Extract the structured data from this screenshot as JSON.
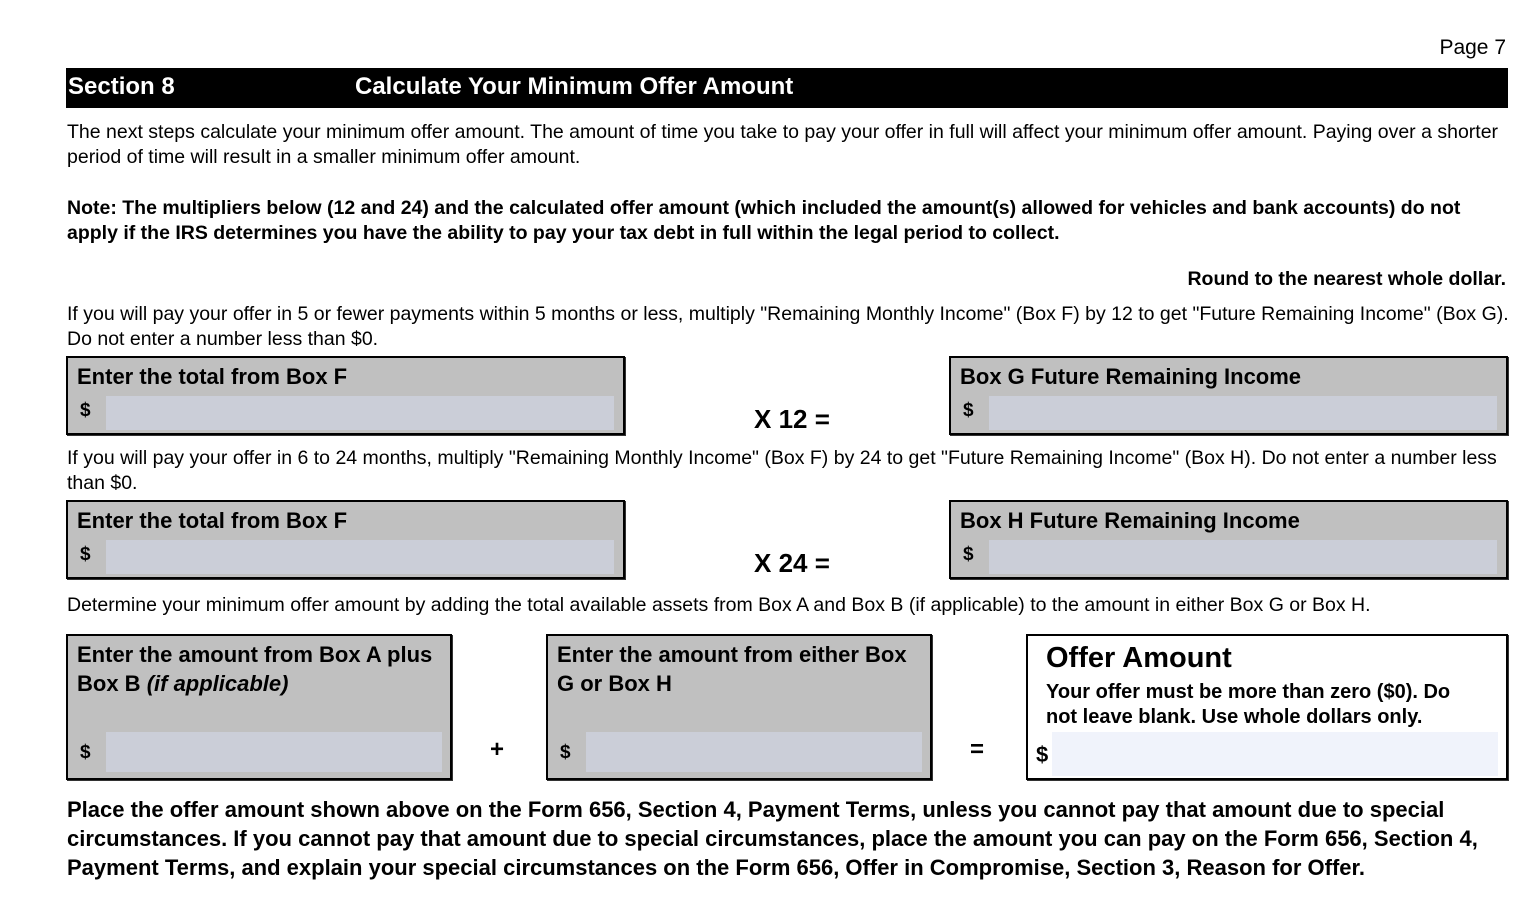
{
  "page": {
    "number_label": "Page 7"
  },
  "section": {
    "number": "Section 8",
    "title": "Calculate Your Minimum Offer Amount"
  },
  "intro": "The next steps calculate your minimum offer amount. The amount of time you take to pay your offer in full will affect your minimum offer amount. Paying over a shorter period of time will result in a smaller minimum offer amount.",
  "note": "Note: The multipliers below (12 and 24) and the calculated offer amount (which included the amount(s) allowed for vehicles and bank accounts) do not apply if the IRS determines you have the ability to pay your tax debt in full within the legal period to collect.",
  "round_note": "Round to the nearest whole dollar.",
  "calc12": {
    "instruction": "If you will pay your offer in 5 or fewer payments within 5 months or less, multiply \"Remaining Monthly Income\" (Box F)  by 12 to get \"Future Remaining Income\" (Box G). Do not enter a number less than $0.",
    "left_label": "Enter the total from Box F",
    "left_value": "",
    "operator": "X 12  =",
    "right_label": "Box G Future Remaining Income",
    "right_value": ""
  },
  "calc24": {
    "instruction": "If you will pay your offer in 6 to 24 months, multiply \"Remaining Monthly Income\" (Box F) by 24 to get \"Future Remaining Income\" (Box H). Do not enter a number less than $0.",
    "left_label": "Enter the total from Box F",
    "left_value": "",
    "operator": "X 24  =",
    "right_label": "Box H Future Remaining Income",
    "right_value": ""
  },
  "determine": {
    "instruction": "Determine your minimum offer amount by adding the total available assets from Box A and Box B (if applicable) to the amount in either Box G or Box H.",
    "box_ab_label": "Enter the amount from Box A plus Box B",
    "box_ab_label_italic": "(if applicable)",
    "box_ab_value": "",
    "plus": "+",
    "box_gh_label": "Enter the amount from either Box G or Box H",
    "box_gh_value": "",
    "equals": "=",
    "offer_title": "Offer Amount",
    "offer_note": "Your offer must be more than zero ($0). Do not leave blank. Use whole dollars only.",
    "offer_value": ""
  },
  "currency_symbol": "$",
  "final_instruction": "Place the offer amount shown above on the Form 656, Section 4, Payment Terms, unless you cannot pay that amount due to special circumstances. If you cannot pay that amount due to special circumstances, place the amount you can pay on the Form 656, Section 4, Payment Terms, and explain your special circumstances on the Form 656, Offer in Compromise, Section 3, Reason for Offer."
}
